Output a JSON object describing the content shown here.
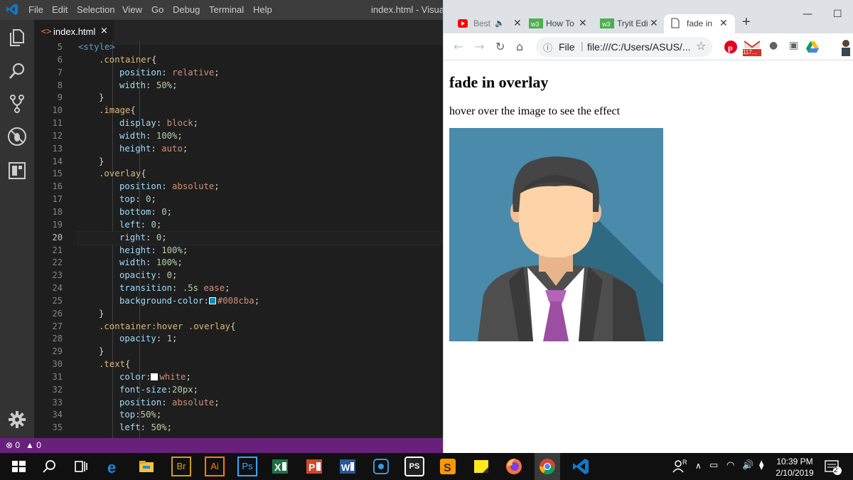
{
  "vscode": {
    "menu": [
      "File",
      "Edit",
      "Selection",
      "View",
      "Go",
      "Debug",
      "Terminal",
      "Help"
    ],
    "window_title": "index.html - Visual S",
    "tab": {
      "label": "index.html",
      "close": "×"
    },
    "line_numbers": [
      "5",
      "6",
      "7",
      "8",
      "9",
      "10",
      "11",
      "12",
      "13",
      "14",
      "15",
      "16",
      "17",
      "18",
      "19",
      "20",
      "21",
      "22",
      "23",
      "24",
      "25",
      "26",
      "27",
      "28",
      "29",
      "30",
      "31",
      "32",
      "33",
      "34",
      "35"
    ],
    "current_line": "20",
    "code": [
      [
        [
          "tag",
          "<style>"
        ]
      ],
      [
        [
          "sel",
          ".container"
        ],
        [
          "pun",
          "{"
        ]
      ],
      [
        [
          "prop",
          "position"
        ],
        [
          "pun",
          ": "
        ],
        [
          "val",
          "relative"
        ],
        [
          "pun",
          ";"
        ]
      ],
      [
        [
          "prop",
          "width"
        ],
        [
          "pun",
          ": "
        ],
        [
          "num",
          "50%"
        ],
        [
          "pun",
          ";"
        ]
      ],
      [
        [
          "pun",
          "}"
        ]
      ],
      [
        [
          "sel",
          ".image"
        ],
        [
          "pun",
          "{"
        ]
      ],
      [
        [
          "prop",
          "display"
        ],
        [
          "pun",
          ": "
        ],
        [
          "val",
          "block"
        ],
        [
          "pun",
          ";"
        ]
      ],
      [
        [
          "prop",
          "width"
        ],
        [
          "pun",
          ": "
        ],
        [
          "num",
          "100%"
        ],
        [
          "pun",
          ";"
        ]
      ],
      [
        [
          "prop",
          "height"
        ],
        [
          "pun",
          ": "
        ],
        [
          "val",
          "auto"
        ],
        [
          "pun",
          ";"
        ]
      ],
      [
        [
          "pun",
          "}"
        ]
      ],
      [
        [
          "sel",
          ".overlay"
        ],
        [
          "pun",
          "{"
        ]
      ],
      [
        [
          "prop",
          "position"
        ],
        [
          "pun",
          ": "
        ],
        [
          "val",
          "absolute"
        ],
        [
          "pun",
          ";"
        ]
      ],
      [
        [
          "prop",
          "top"
        ],
        [
          "pun",
          ": "
        ],
        [
          "num",
          "0"
        ],
        [
          "pun",
          ";"
        ]
      ],
      [
        [
          "prop",
          "bottom"
        ],
        [
          "pun",
          ": "
        ],
        [
          "num",
          "0"
        ],
        [
          "pun",
          ";"
        ]
      ],
      [
        [
          "prop",
          "left"
        ],
        [
          "pun",
          ": "
        ],
        [
          "num",
          "0"
        ],
        [
          "pun",
          ";"
        ]
      ],
      [
        [
          "prop",
          "right"
        ],
        [
          "pun",
          ": "
        ],
        [
          "num",
          "0"
        ],
        [
          "pun",
          ";"
        ]
      ],
      [
        [
          "prop",
          "height"
        ],
        [
          "pun",
          ": "
        ],
        [
          "num",
          "100%"
        ],
        [
          "pun",
          ";"
        ]
      ],
      [
        [
          "prop",
          "width"
        ],
        [
          "pun",
          ": "
        ],
        [
          "num",
          "100%"
        ],
        [
          "pun",
          ";"
        ]
      ],
      [
        [
          "prop",
          "opacity"
        ],
        [
          "pun",
          ": "
        ],
        [
          "num",
          "0"
        ],
        [
          "pun",
          ";"
        ]
      ],
      [
        [
          "prop",
          "transition"
        ],
        [
          "pun",
          ": "
        ],
        [
          "num",
          ".5s"
        ],
        [
          "pun",
          " "
        ],
        [
          "val",
          "ease"
        ],
        [
          "pun",
          ";"
        ]
      ],
      [
        [
          "prop",
          "background-color"
        ],
        [
          "pun",
          ":"
        ],
        [
          "swatch",
          "#008cba"
        ],
        [
          "val",
          "#008cba"
        ],
        [
          "pun",
          ";"
        ]
      ],
      [
        [
          "pun",
          "}"
        ]
      ],
      [
        [
          "sel",
          ".container:hover .overlay"
        ],
        [
          "pun",
          "{"
        ]
      ],
      [
        [
          "prop",
          "opacity"
        ],
        [
          "pun",
          ": "
        ],
        [
          "num",
          "1"
        ],
        [
          "pun",
          ";"
        ]
      ],
      [
        [
          "pun",
          "}"
        ]
      ],
      [
        [
          "sel",
          ".text"
        ],
        [
          "pun",
          "{"
        ]
      ],
      [
        [
          "prop",
          "color"
        ],
        [
          "pun",
          ":"
        ],
        [
          "swatch",
          "#ffffff"
        ],
        [
          "val",
          "white"
        ],
        [
          "pun",
          ";"
        ]
      ],
      [
        [
          "prop",
          "font-size"
        ],
        [
          "pun",
          ":"
        ],
        [
          "num",
          "20px"
        ],
        [
          "pun",
          ";"
        ]
      ],
      [
        [
          "prop",
          "position"
        ],
        [
          "pun",
          ": "
        ],
        [
          "val",
          "absolute"
        ],
        [
          "pun",
          ";"
        ]
      ],
      [
        [
          "prop",
          "top"
        ],
        [
          "pun",
          ":"
        ],
        [
          "num",
          "50%"
        ],
        [
          "pun",
          ";"
        ]
      ],
      [
        [
          "prop",
          "left"
        ],
        [
          "pun",
          ": "
        ],
        [
          "num",
          "50%"
        ],
        [
          "pun",
          ";"
        ]
      ]
    ],
    "status": {
      "errors": "0",
      "warnings": "0"
    }
  },
  "chrome": {
    "tabs": [
      {
        "label": "Best",
        "icon": "youtube-icon",
        "sound": "🔈"
      },
      {
        "label": "How To",
        "icon": "w3schools-icon"
      },
      {
        "label": "Tryit Edi",
        "icon": "w3schools-icon"
      },
      {
        "label": "fade in",
        "icon": "document-icon"
      }
    ],
    "new_tab": "+",
    "address_scheme": "File",
    "address_url": "file:///C:/Users/ASUS/...",
    "ext_badge": "117..."
  },
  "page": {
    "heading": "fade in overlay",
    "paragraph": "hover over the image to see the effect"
  },
  "taskbar": {
    "apps": [
      "windows-start-icon",
      "search-icon",
      "task-view-icon",
      "edge-icon",
      "file-explorer-icon",
      "bridge-icon",
      "illustrator-icon",
      "photoshop-icon",
      "excel-icon",
      "powerpoint-icon",
      "word-icon",
      "network-app-icon",
      "phpstorm-icon",
      "sublime-icon",
      "sticky-notes-icon",
      "firefox-icon",
      "chrome-icon",
      "vscode-icon"
    ],
    "app_labels": {
      "br": "Br",
      "ai": "Ai",
      "ps": "Ps",
      "ps2": "PS"
    },
    "time": "10:39 PM",
    "date": "2/10/2019",
    "notif_count": "2"
  },
  "colors": {
    "vs_bg": "#1e1e1e",
    "vs_status": "#68217a",
    "chrome_strip": "#dee1e6",
    "overlay_color": "#008cba"
  }
}
